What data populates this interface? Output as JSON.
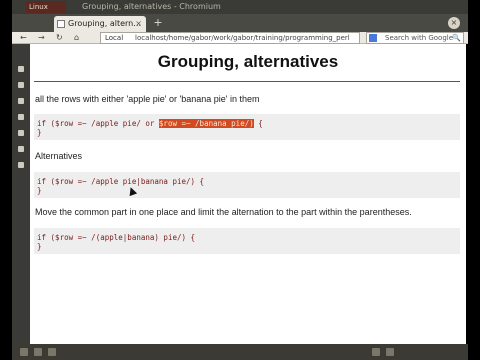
{
  "window": {
    "title": "Grouping, alternatives - Chromium"
  },
  "app": {
    "logo_text": "Linux"
  },
  "tab": {
    "label": "Grouping, altern…",
    "close": "×",
    "new_tab": "+"
  },
  "nav": {
    "back": "←",
    "forward": "→",
    "reload": "↻",
    "home": "⌂",
    "url_scheme": "Local",
    "url": "localhost/home/gabor/work/gabor/training/programming_perl",
    "search_placeholder": "Search with Google",
    "search_icon": "🔍"
  },
  "page": {
    "title": "Grouping, alternatives",
    "para1": "all the rows with either 'apple pie' or 'banana pie' in them",
    "code1": {
      "pre": "if ($row =~ /apple pie/ or ",
      "sel": "$row =~ /banana pie/)",
      "post": " {",
      "close": "}"
    },
    "para2": "Alternatives",
    "code2": {
      "line1": "if ($row =~ /apple pie|banana pie/) {",
      "close": "}"
    },
    "para3": "Move the common part in one place and limit the alternation to the part within the parentheses.",
    "code3": {
      "line1": "if ($row =~ /(apple|banana) pie/) {",
      "close": "}"
    }
  },
  "colors": {
    "selection": "#d24a1f",
    "code_bg": "#eeeeee",
    "code_text": "#7a1a1a"
  }
}
